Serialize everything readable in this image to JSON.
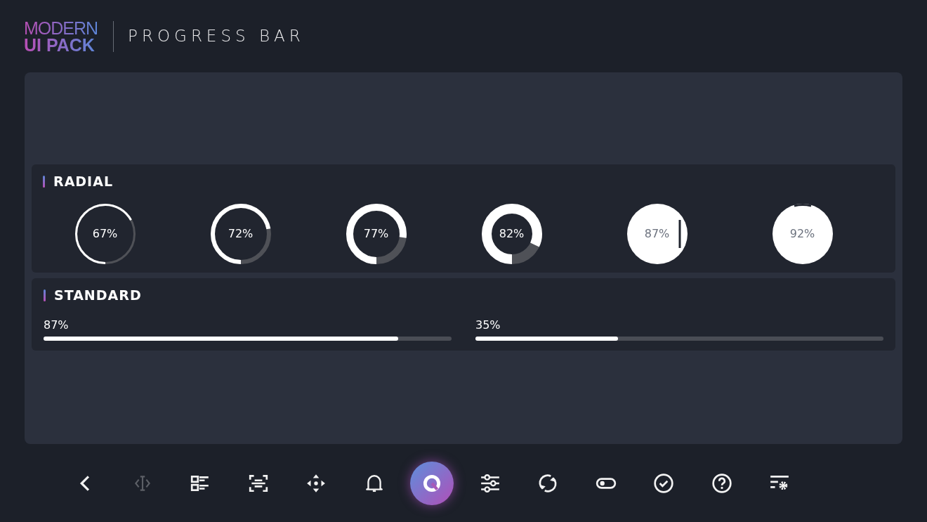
{
  "logo": {
    "line1": "MODERN",
    "line2": "UI PACK"
  },
  "page_title": "PROGRESS BAR",
  "radial": {
    "title": "RADIAL",
    "items": [
      {
        "kind": "ring",
        "reading": "67%"
      },
      {
        "kind": "ring",
        "level": 0.72,
        "reading": "72%"
      },
      {
        "kind": "ring",
        "level": 0.77,
        "reading": "77%"
      },
      {
        "kind": "ring",
        "level": 0.82,
        "reading": "82%"
      },
      {
        "kind": "disc",
        "reading": "87%"
      },
      {
        "kind": "disc",
        "reading": "92%"
      }
    ]
  },
  "standard": {
    "title": "STANDARD",
    "items": [
      {
        "level": 0.87,
        "reading": "87%"
      },
      {
        "level": 0.35,
        "reading": "35%"
      }
    ]
  },
  "toolbar": [
    {
      "selected": false,
      "disabled": false
    },
    {
      "selected": false,
      "disabled": true
    },
    {
      "selected": false,
      "disabled": false
    },
    {
      "selected": false,
      "disabled": false
    },
    {
      "selected": false,
      "disabled": false
    },
    {
      "selected": false,
      "disabled": false
    },
    {
      "selected": true,
      "disabled": false
    },
    {
      "selected": false,
      "disabled": false
    },
    {
      "selected": false,
      "disabled": false
    },
    {
      "selected": false,
      "disabled": false
    },
    {
      "selected": false,
      "disabled": false
    },
    {
      "selected": false,
      "disabled": false
    },
    {
      "selected": false,
      "disabled": false
    }
  ]
}
